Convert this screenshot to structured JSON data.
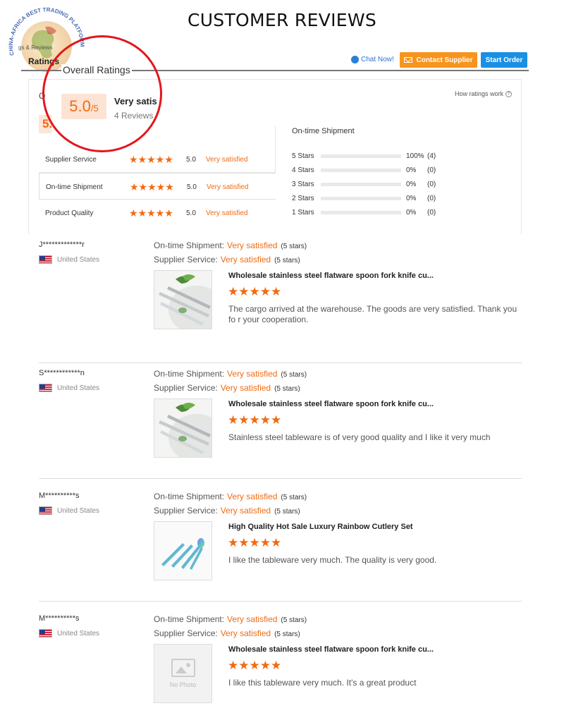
{
  "page_heading": "CUSTOMER REVIEWS",
  "logo": {
    "arc_text": "CHINA-AFRICA BEST TRADING PLATFORM",
    "overlay_text": "gs & Reviews"
  },
  "nav": {
    "tab_label": "Ratings",
    "chat_now": "Chat Now!",
    "contact_supplier": "Contact Supplier",
    "start_order": "Start Order"
  },
  "overall": {
    "title": "Overall Ratings",
    "ghost_letter": "O",
    "ghost_score": "5.",
    "score": "5.0",
    "score_max": "/5",
    "score_text": "Very satis",
    "review_count": "4 Reviews",
    "how_ratings_work": "How ratings work"
  },
  "categories": [
    {
      "label": "Supplier Service",
      "stars": "★★★★★",
      "score": "5.0",
      "status": "Very satisfied"
    },
    {
      "label": "On-time Shipment",
      "stars": "★★★★★",
      "score": "5.0",
      "status": "Very satisfied"
    },
    {
      "label": "Product Quality",
      "stars": "★★★★★",
      "score": "5.0",
      "status": "Very satisfied"
    }
  ],
  "distribution": {
    "title": "On-time Shipment",
    "rows": [
      {
        "label": "5  Stars",
        "fraction": 1.0,
        "percent": "100%",
        "count": "(4)"
      },
      {
        "label": "4  Stars",
        "fraction": 0.0,
        "percent": "0%",
        "count": "(0)"
      },
      {
        "label": "3  Stars",
        "fraction": 0.0,
        "percent": "0%",
        "count": "(0)"
      },
      {
        "label": "2  Stars",
        "fraction": 0.0,
        "percent": "0%",
        "count": "(0)"
      },
      {
        "label": "1  Stars",
        "fraction": 0.0,
        "percent": "0%",
        "count": "(0)"
      }
    ]
  },
  "reviews": [
    {
      "name": "J*************r",
      "country": "United States",
      "shipment_label": "On-time Shipment:",
      "shipment_value": "Very satisfied",
      "shipment_stars": "(5 stars)",
      "service_label": "Supplier Service:",
      "service_value": "Very satisfied",
      "service_stars": "(5 stars)",
      "product": "Wholesale stainless steel flatware spoon fork knife cu...",
      "stars": "★★★★★",
      "text": "The cargo arrived at the warehouse. The goods are very satisfied. Thank you fo r your cooperation.",
      "thumb": "flatware"
    },
    {
      "name": "S************n",
      "country": "United States",
      "shipment_label": "On-time Shipment:",
      "shipment_value": "Very satisfied",
      "shipment_stars": "(5 stars)",
      "service_label": "Supplier Service:",
      "service_value": "Very satisfied",
      "service_stars": "(5 stars)",
      "product": "Wholesale stainless steel flatware spoon fork knife cu...",
      "stars": "★★★★★",
      "text": "Stainless steel tableware is of very good quality and I like it very much",
      "thumb": "flatware"
    },
    {
      "name": "M**********s",
      "country": "United States",
      "shipment_label": "On-time Shipment:",
      "shipment_value": "Very satisfied",
      "shipment_stars": "(5 stars)",
      "service_label": "Supplier Service:",
      "service_value": "Very satisfied",
      "service_stars": "(5 stars)",
      "product": "High Quality Hot Sale Luxury Rainbow Cutlery Set",
      "stars": "★★★★★",
      "text": "I like the tableware very much. The quality is very good.",
      "thumb": "rainbow"
    },
    {
      "name": "M**********s",
      "country": "United States",
      "shipment_label": "On-time Shipment:",
      "shipment_value": "Very satisfied",
      "shipment_stars": "(5 stars)",
      "service_label": "Supplier Service:",
      "service_value": "Very satisfied",
      "service_stars": "(5 stars)",
      "product": "Wholesale stainless steel flatware spoon fork knife cu...",
      "stars": "★★★★★",
      "text": "I like this tableware very much. It's a great product",
      "thumb": "nophoto",
      "no_photo_label": "No Photo"
    }
  ],
  "colors": {
    "accent_orange": "#f26a10",
    "contact_button": "#f8941d",
    "start_button": "#1a8fe3",
    "highlight_circle": "#e3161d"
  }
}
